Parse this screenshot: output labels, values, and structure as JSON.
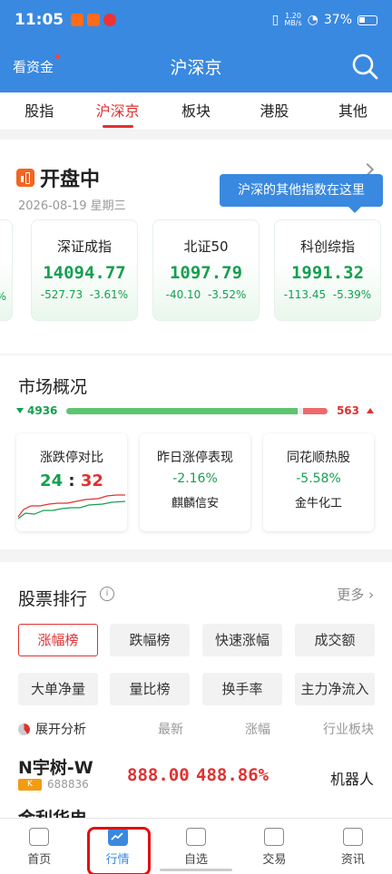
{
  "status_bar": {
    "time": "11:05",
    "speed_top": "1.20",
    "speed_unit": "MB/s",
    "battery": "37%"
  },
  "app_bar": {
    "left_label": "看资金",
    "title": "沪深京"
  },
  "tabs": [
    {
      "label": "股指",
      "active": false
    },
    {
      "label": "沪深京",
      "active": true
    },
    {
      "label": "板块",
      "active": false
    },
    {
      "label": "港股",
      "active": false
    },
    {
      "label": "其他",
      "active": false
    }
  ],
  "open_section": {
    "title": "开盘中",
    "date": "2026-08-19 星期三",
    "tooltip": "沪深的其他指数在这里"
  },
  "indices": [
    {
      "name": "深证成指",
      "value": "14094.77",
      "change": "-527.73",
      "pct": "-3.61%"
    },
    {
      "name": "北证50",
      "value": "1097.79",
      "change": "-40.10",
      "pct": "-3.52%"
    },
    {
      "name": "科创综指",
      "value": "1991.32",
      "change": "-113.45",
      "pct": "-5.39%"
    }
  ],
  "partial_left_pct": "%",
  "market": {
    "title": "市场概况",
    "down_count": "4936",
    "up_count": "563",
    "down_fraction": 0.897,
    "cards": [
      {
        "title": "涨跌停对比",
        "ratio_down": "24",
        "sep": ":",
        "ratio_up": "32"
      },
      {
        "title": "昨日涨停表现",
        "value": "-2.16%",
        "name": "麒麟信安"
      },
      {
        "title": "同花顺热股",
        "value": "-5.58%",
        "name": "金牛化工"
      }
    ]
  },
  "rank": {
    "title": "股票排行",
    "more": "更多",
    "chips": [
      "涨幅榜",
      "跌幅榜",
      "快速涨幅",
      "成交额",
      "大单净量",
      "量比榜",
      "换手率",
      "主力净流入"
    ],
    "expand": "展开分析",
    "columns": [
      "最新",
      "涨幅",
      "行业板块"
    ],
    "rows": [
      {
        "name": "N宇树-W",
        "badge": "K",
        "code": "688836",
        "price": "888.00",
        "pct": "488.86%",
        "sector": "机器人"
      }
    ],
    "next_partial": "金利华电"
  },
  "bottom_nav": [
    {
      "label": "首页",
      "icon": "home-icon",
      "active": false
    },
    {
      "label": "行情",
      "icon": "market-chart-icon",
      "active": true
    },
    {
      "label": "自选",
      "icon": "folder-icon",
      "active": false
    },
    {
      "label": "交易",
      "icon": "trade-icon",
      "active": false
    },
    {
      "label": "资讯",
      "icon": "news-icon",
      "active": false
    }
  ],
  "colors": {
    "brand_blue": "#3a89e0",
    "up_red": "#e03131",
    "down_green": "#14a050"
  }
}
